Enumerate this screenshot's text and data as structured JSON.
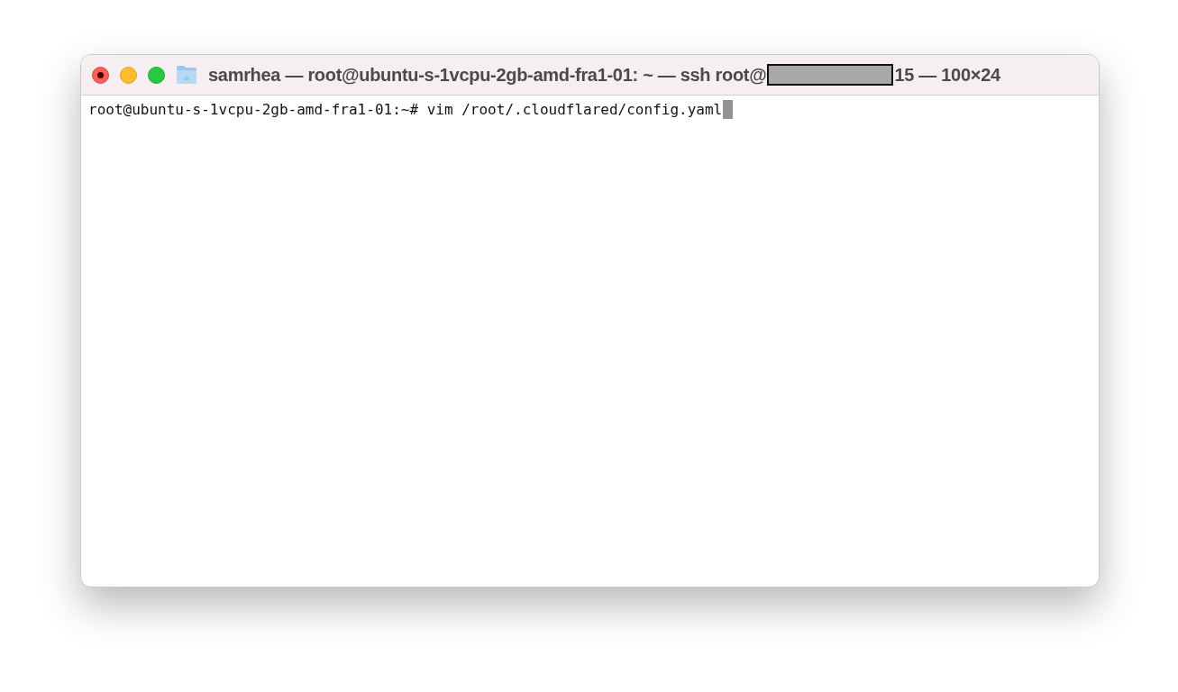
{
  "window": {
    "title_start": "samrhea — root@ubuntu-s-1vcpu-2gb-amd-fra1-01: ~ — ssh root@",
    "title_end": "15 — 100×24"
  },
  "terminal": {
    "lines": [
      {
        "text": "root@ubuntu-s-1vcpu-2gb-amd-fra1-01:~# vim /root/.cloudflared/config.yaml",
        "cursor": true
      }
    ]
  }
}
